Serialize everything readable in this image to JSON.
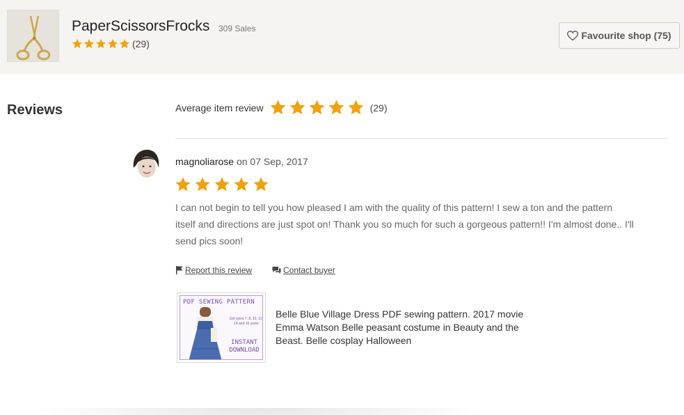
{
  "shop": {
    "name": "PaperScissorsFrocks",
    "sales": "309 Sales",
    "rating_stars": 5,
    "rating_count": "(29)",
    "logo_icon": "scissors-icon",
    "favourite_label": "Favourite shop (75)"
  },
  "reviews": {
    "title": "Reviews",
    "average_label": "Average item review",
    "average_stars": 5,
    "average_count": "(29)"
  },
  "review": {
    "reviewer": "magnoliarose",
    "date_text": " on 07 Sep, 2017",
    "stars": 5,
    "text": "I can not begin to tell you how pleased I am with the quality of this pattern! I sew a ton and the pattern itself and directions are just spot on! Thank you so much for such a gorgeous pattern!! I'm almost done.. I'll send pics soon!",
    "report_label": "Report this review",
    "contact_label": "Contact buyer"
  },
  "listing": {
    "thumb_heading": "PDF SEWING PATTERN",
    "thumb_sizes": "Girl sizes 7, 8, 10, 12, 14 and 16 years",
    "thumb_instant": "INSTANT DOWNLOAD",
    "title": "Belle Blue Village Dress PDF sewing pattern. 2017 movie Emma Watson Belle peasant costume in Beauty and the Beast. Belle cosplay Halloween"
  },
  "colors": {
    "star": "#f1a10d",
    "header_bg": "#f5f4f1",
    "thumb_accent": "#7a4fa8"
  }
}
